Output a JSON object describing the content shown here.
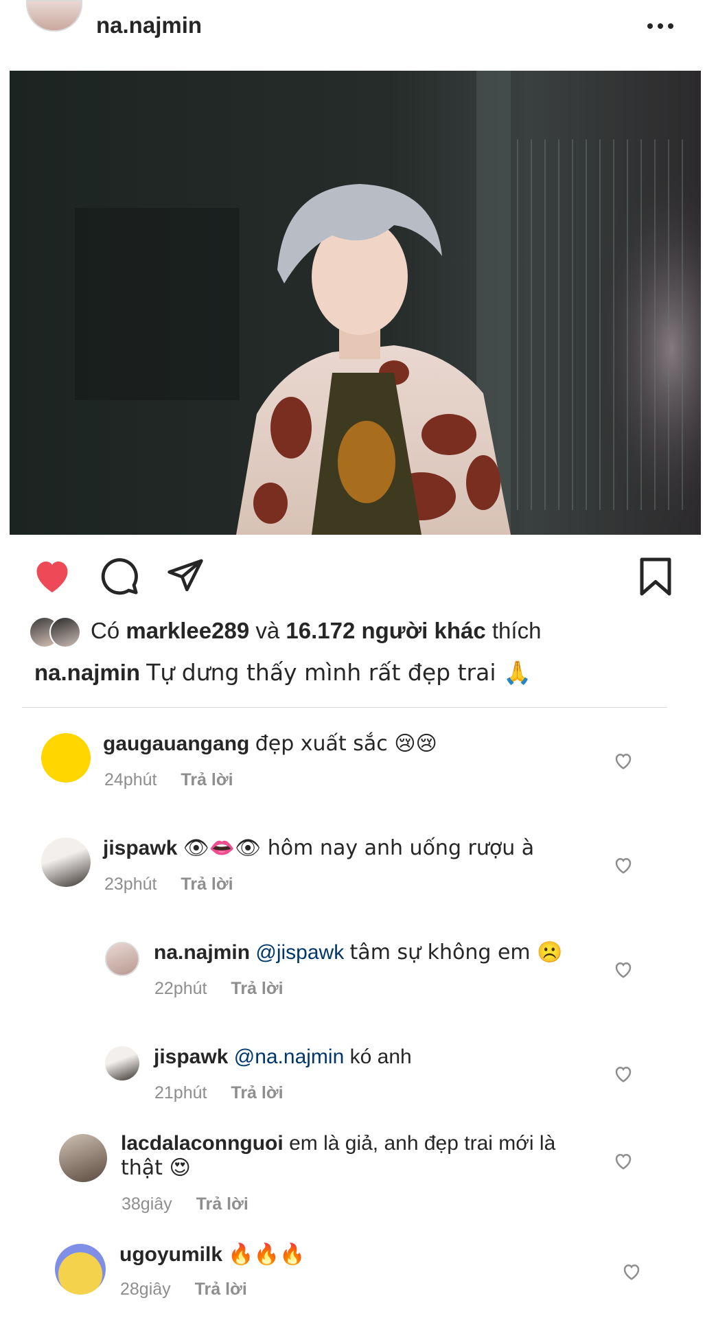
{
  "post": {
    "username": "na.najmin",
    "more_icon": "more-icon"
  },
  "actions": {
    "like_icon": "heart-filled-icon",
    "comment_icon": "comment-icon",
    "share_icon": "send-icon",
    "save_icon": "bookmark-icon",
    "like_color": "#ed4956"
  },
  "likes": {
    "prefix": "Có",
    "user": "marklee289",
    "connector": "và",
    "count": "16.172 người khác",
    "suffix": "thích"
  },
  "caption": {
    "username": "na.najmin",
    "text": "Tự dưng thấy mình rất đẹp trai 🙏"
  },
  "comments": [
    {
      "username": "gaugauangang",
      "text": "đẹp xuất sắc 😢😢",
      "time": "24phút",
      "reply": "Trả lời"
    },
    {
      "username": "jispawk",
      "text": "👁👄👁 hôm nay anh uống rượu à",
      "time": "23phút",
      "reply": "Trả lời"
    },
    {
      "username": "na.najmin",
      "mention": "@jispawk",
      "text": "tâm sự không em ☹️",
      "time": "22phút",
      "reply": "Trả lời"
    },
    {
      "username": "jispawk",
      "mention": "@na.najmin",
      "text": "kó anh",
      "time": "21phút",
      "reply": "Trả lời"
    },
    {
      "username": "lacdalaconnguoi",
      "text": "em là giả, anh đẹp trai mới là",
      "text2": "thật 😍",
      "time": "38giây",
      "reply": "Trả lời"
    },
    {
      "username": "ugoyumilk",
      "text": "🔥🔥🔥",
      "time": "28giây",
      "reply": "Trả lời"
    }
  ]
}
